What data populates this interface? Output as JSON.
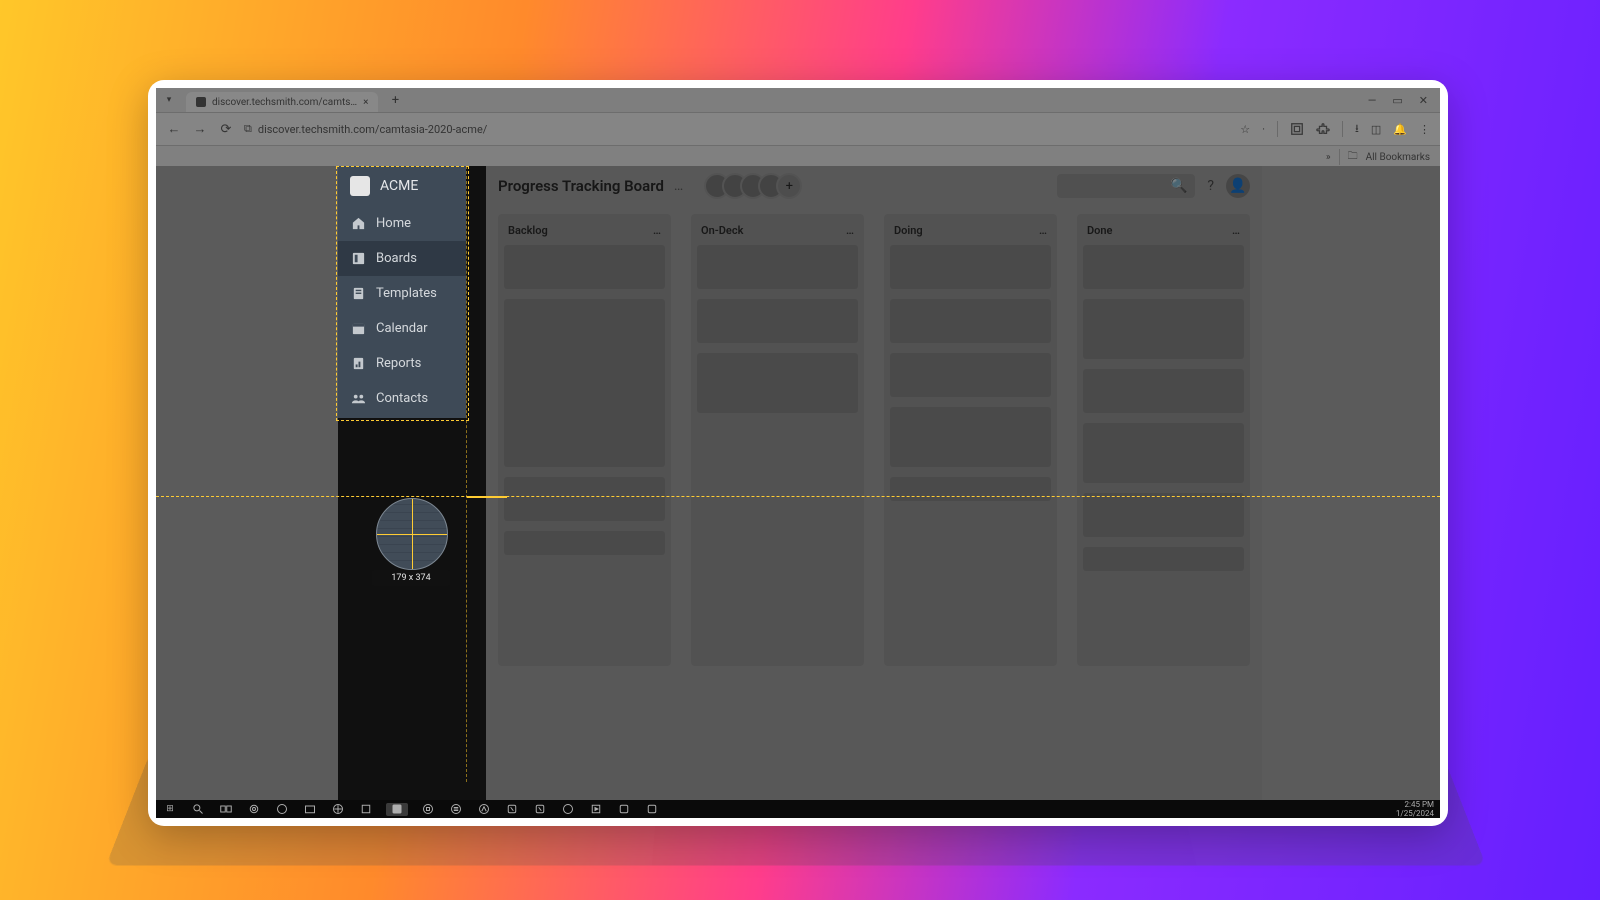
{
  "browser": {
    "tab_title": "discover.techsmith.com/camts…",
    "tab_close_glyph": "×",
    "new_tab_glyph": "+",
    "tab_menu_glyph": "▾",
    "window_minimize_glyph": "—",
    "window_restore_glyph": "▭",
    "window_close_glyph": "✕",
    "nav_back_glyph": "←",
    "nav_forward_glyph": "→",
    "nav_reload_glyph": "⟳",
    "site_info_glyph": "⧉",
    "url": "discover.techsmith.com/camtasia-2020-acme/",
    "star_glyph": "☆",
    "ext_spacer_glyph": "·",
    "download_glyph": "⭳",
    "panel_glyph": "◫",
    "bell_glyph": "🔔",
    "menu_glyph": "⋮",
    "bookmarks_chevron": "»",
    "all_bookmarks_label": "All Bookmarks",
    "folder_glyph": "🗀"
  },
  "sidebar": {
    "workspace_name": "ACME",
    "items": [
      {
        "label": "Home",
        "icon": "home-icon"
      },
      {
        "label": "Boards",
        "icon": "board-icon"
      },
      {
        "label": "Templates",
        "icon": "template-icon"
      },
      {
        "label": "Calendar",
        "icon": "calendar-icon"
      },
      {
        "label": "Reports",
        "icon": "reports-icon"
      },
      {
        "label": "Contacts",
        "icon": "contacts-icon"
      }
    ]
  },
  "board": {
    "title": "Progress Tracking Board",
    "more_glyph": "…",
    "add_member_glyph": "+",
    "search_icon_glyph": "🔍",
    "help_glyph": "?",
    "user_glyph": "👤",
    "columns": [
      {
        "name": "Backlog",
        "cards": [
          "md",
          "xl",
          "md",
          "sm"
        ]
      },
      {
        "name": "On-Deck",
        "cards": [
          "md",
          "md",
          "lg"
        ]
      },
      {
        "name": "Doing",
        "cards": [
          "md",
          "md",
          "md",
          "lg",
          "sm"
        ]
      },
      {
        "name": "Done",
        "cards": [
          "md",
          "lg",
          "md",
          "lg",
          "md",
          "sm"
        ]
      }
    ],
    "col_more_glyph": "…"
  },
  "capture": {
    "selection_size_label": "179 x 374"
  },
  "taskbar": {
    "time": "2:45 PM",
    "date": "1/25/2024",
    "start_glyph": "⊞",
    "search_glyph": "🔍",
    "taskview_glyph": "⧉"
  }
}
